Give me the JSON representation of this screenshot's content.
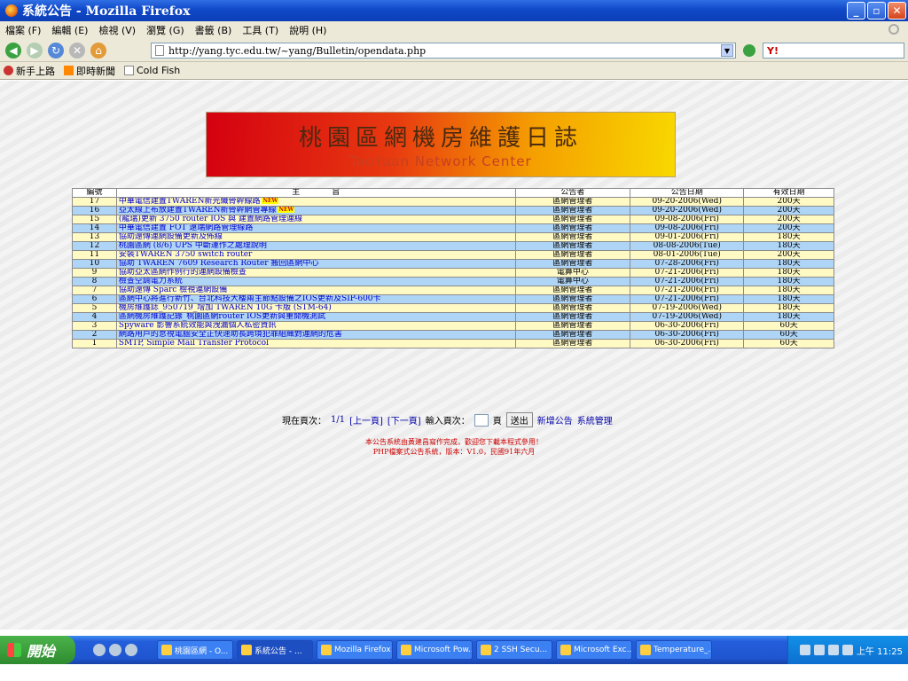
{
  "window": {
    "title": "系統公告 - Mozilla Firefox"
  },
  "menu": [
    "檔案 (F)",
    "編輯 (E)",
    "檢視 (V)",
    "瀏覽 (G)",
    "書籤 (B)",
    "工具 (T)",
    "說明 (H)"
  ],
  "url": "http://yang.tyc.edu.tw/~yang/Bulletin/opendata.php",
  "search_label": "Y!",
  "bookmarks": [
    "新手上路",
    "即時新聞",
    "Cold Fish"
  ],
  "banner": {
    "title": "桃園區網機房維護日誌",
    "subtitle": "TaoYuan Network Center"
  },
  "table": {
    "headers": [
      "編號",
      "主　　　　旨",
      "公告者",
      "公告日期",
      "有效日期"
    ],
    "rows": [
      {
        "no": "17",
        "subject": "中華電信建置TWAREN新光纖骨幹線路",
        "new": true,
        "author": "區網管理者",
        "date": "09-20-2006(Wed)",
        "valid": "200天"
      },
      {
        "no": "16",
        "subject": "亞太線上布放建置TWAREN新骨幹網管專線",
        "new": true,
        "author": "區網管理者",
        "date": "09-20-2006(Wed)",
        "valid": "200天"
      },
      {
        "no": "15",
        "subject": "(龍瑞)更新 3750 router IOS 與 建置網路管理連線",
        "new": false,
        "author": "區網管理者",
        "date": "09-08-2006(Fri)",
        "valid": "200天"
      },
      {
        "no": "14",
        "subject": "中華電信建置 FOT 遠端網路管理線路",
        "new": false,
        "author": "區網管理者",
        "date": "09-08-2006(Fri)",
        "valid": "200天"
      },
      {
        "no": "13",
        "subject": "協助遠傳連網設備更新及佈線",
        "new": false,
        "author": "區網管理者",
        "date": "09-01-2006(Fri)",
        "valid": "180天"
      },
      {
        "no": "12",
        "subject": "桃園區網 (8/6) UPS 中斷運作之處理說明",
        "new": false,
        "author": "區網管理者",
        "date": "08-08-2006(Tue)",
        "valid": "180天"
      },
      {
        "no": "11",
        "subject": "安裝TWAREN 3750 switch router",
        "new": false,
        "author": "區網管理者",
        "date": "08-01-2006(Tue)",
        "valid": "200天"
      },
      {
        "no": "10",
        "subject": "協助 TWAREN 7609 Research Router 搬回區網中心",
        "new": false,
        "author": "區網管理者",
        "date": "07-28-2006(Fri)",
        "valid": "180天"
      },
      {
        "no": "9",
        "subject": "協助亞太區網作例行的連網設備檢查",
        "new": false,
        "author": "電算中心",
        "date": "07-21-2006(Fri)",
        "valid": "180天"
      },
      {
        "no": "8",
        "subject": "檢查空調電力系統",
        "new": false,
        "author": "電算中心",
        "date": "07-21-2006(Fri)",
        "valid": "180天"
      },
      {
        "no": "7",
        "subject": "協助遠傳 Sparc 檢視連網設備",
        "new": false,
        "author": "區網管理者",
        "date": "07-21-2006(Fri)",
        "valid": "180天"
      },
      {
        "no": "6",
        "subject": "區網中心將進行新竹、台北科技大樓兩主節點設備之IOS更新及SIP-600卡",
        "new": false,
        "author": "區網管理者",
        "date": "07-21-2006(Fri)",
        "valid": "180天"
      },
      {
        "no": "5",
        "subject": "機房維護誌_950719_增加 TWAREN 10G 卡版 (STM-64)",
        "new": false,
        "author": "區網管理者",
        "date": "07-19-2006(Wed)",
        "valid": "180天"
      },
      {
        "no": "4",
        "subject": "區網機房維護記錄_桃園區網router IOS更新與重開機測試",
        "new": false,
        "author": "區網管理者",
        "date": "07-19-2006(Wed)",
        "valid": "180天"
      },
      {
        "no": "3",
        "subject": "Spyware 影響系統效能與洩漏個人私密資訊",
        "new": false,
        "author": "區網管理者",
        "date": "06-30-2006(Fri)",
        "valid": "60天"
      },
      {
        "no": "2",
        "subject": "網路用戶的怠視電腦安全正快速助長跨境犯罪組織對連網的危害",
        "new": false,
        "author": "區網管理者",
        "date": "06-30-2006(Fri)",
        "valid": "60天"
      },
      {
        "no": "1",
        "subject": "SMTP, Simple Mail Transfer Protocol",
        "new": false,
        "author": "區網管理者",
        "date": "06-30-2006(Fri)",
        "valid": "60天"
      }
    ],
    "new_badge": "NEW"
  },
  "pager": {
    "label": "現在頁次：",
    "current": "1/1",
    "prev": "[上一頁]",
    "next": "[下一頁]",
    "goto_label": "輸入頁次：",
    "page_unit": "頁",
    "submit": "送出",
    "new_post": "新增公告",
    "admin": "系統管理"
  },
  "footer": {
    "line1": "本公告系統由黃建昌寫作完成，歡迎您下載本程式參用！",
    "line2": "PHP檔案式公告系統，版本：V1.0，民國91年六月"
  },
  "taskbar": {
    "start": "開始",
    "tasks": [
      "桃園區網 - O...",
      "系統公告 - ...",
      "Mozilla Firefox",
      "Microsoft Pow...",
      "2 SSH Secu...",
      "Microsoft Exc...",
      "Temperature_..."
    ],
    "clock": "上午 11:25"
  }
}
